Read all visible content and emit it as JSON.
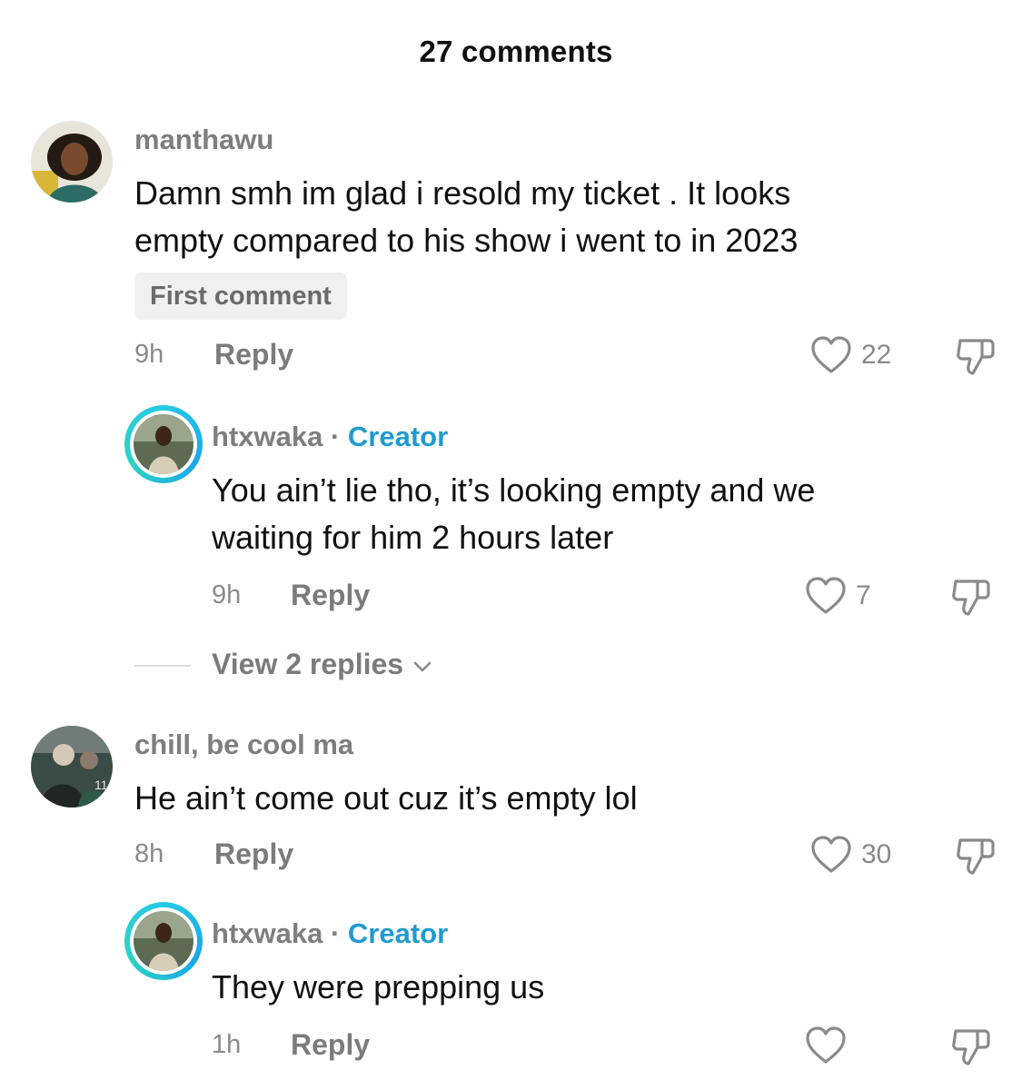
{
  "header": {
    "title": "27 comments"
  },
  "comments": [
    {
      "username": "manthawu",
      "text_lines": [
        "Damn smh im glad i resold my ticket . It looks",
        "empty compared to his show i went to in 2023"
      ],
      "badge": "First comment",
      "time": "9h",
      "reply_label": "Reply",
      "likes": "22",
      "replies": [
        {
          "username": "htxwaka",
          "separator": "·",
          "role": "Creator",
          "text_lines": [
            "You ain’t lie tho, it’s looking empty and we",
            "waiting for him 2 hours later"
          ],
          "time": "9h",
          "reply_label": "Reply",
          "likes": "7"
        }
      ],
      "view_replies_label": "View 2 replies"
    },
    {
      "username": "chill, be cool ma",
      "text_lines": [
        "He ain’t come out cuz it’s empty lol"
      ],
      "time": "8h",
      "reply_label": "Reply",
      "likes": "30",
      "replies": [
        {
          "username": "htxwaka",
          "separator": "·",
          "role": "Creator",
          "text_lines": [
            "They were prepping us"
          ],
          "time": "1h",
          "reply_label": "Reply",
          "likes": ""
        }
      ]
    }
  ],
  "icons": {
    "like": "heart-outline-icon",
    "dislike": "thumbs-down-icon",
    "expand": "chevron-down-icon"
  },
  "colors": {
    "creator_label": "#1f9bd0",
    "creator_ring": "#28c9e6",
    "text_primary": "#111111",
    "text_secondary": "#7e7e7e"
  }
}
